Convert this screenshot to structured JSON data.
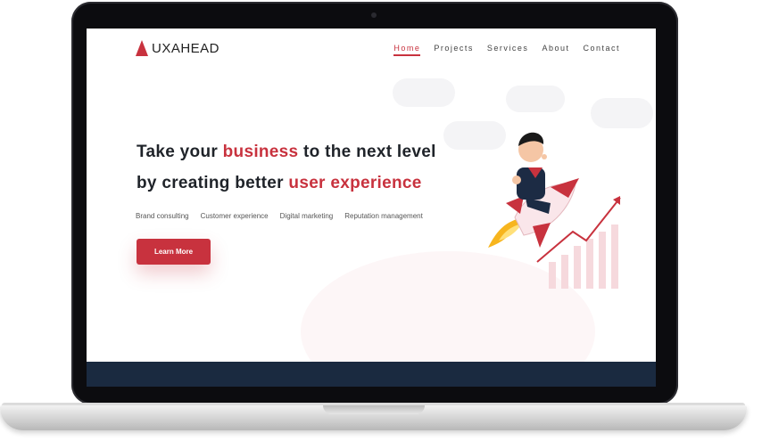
{
  "brand": {
    "name": "UXAHEAD"
  },
  "nav": {
    "items": [
      {
        "label": "Home",
        "active": true
      },
      {
        "label": "Projects"
      },
      {
        "label": "Services"
      },
      {
        "label": "About"
      },
      {
        "label": "Contact"
      }
    ]
  },
  "hero": {
    "line1_a": "Take your ",
    "line1_b": "business",
    "line1_c": " to the next level",
    "line2_a": "by creating better ",
    "line2_b": "user experience",
    "tags": [
      "Brand consulting",
      "Customer experience",
      "Digital marketing",
      "Reputation management"
    ],
    "cta_label": "Learn More"
  },
  "colors": {
    "accent": "#c8323e",
    "dark_band": "#1a2a40"
  },
  "icons": {
    "logo": "triangle-logo-icon",
    "illustration": "rocket-man-illustration"
  }
}
